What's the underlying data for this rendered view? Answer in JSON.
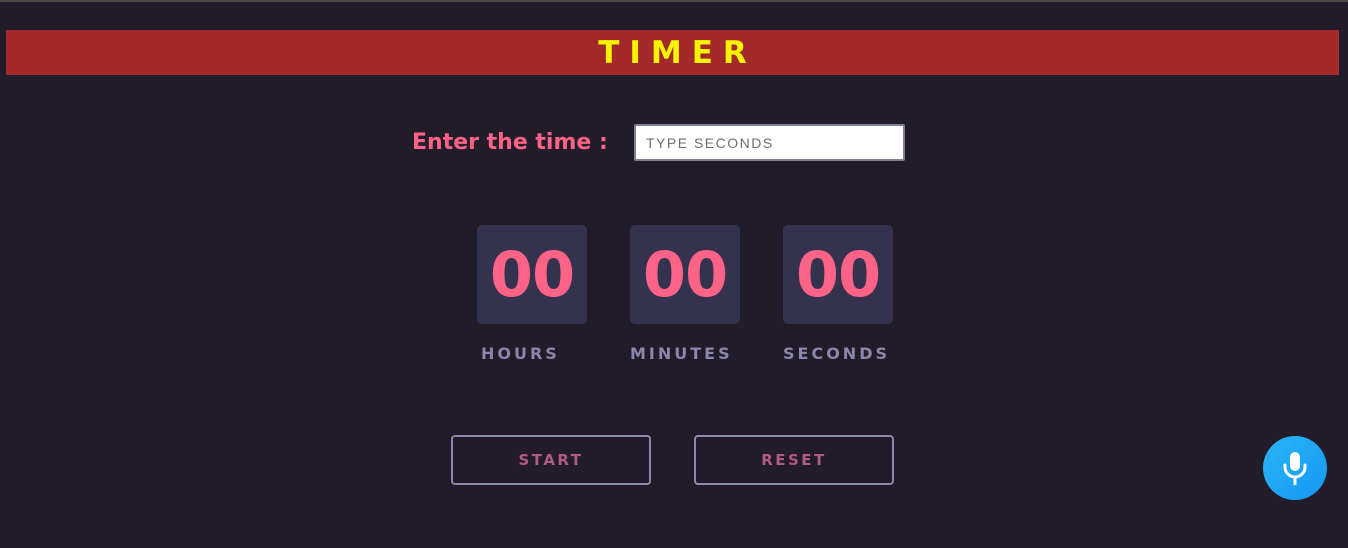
{
  "header": {
    "title": "TIMER"
  },
  "time_input": {
    "label": "Enter the time :",
    "placeholder": "TYPE SECONDS",
    "value": ""
  },
  "countdown": {
    "hours": {
      "value": "00",
      "label": "HOURS"
    },
    "minutes": {
      "value": "00",
      "label": "MINUTES"
    },
    "seconds": {
      "value": "00",
      "label": "SECONDS"
    }
  },
  "controls": {
    "start_label": "START",
    "reset_label": "RESET"
  },
  "voice": {
    "icon": "microphone-icon"
  },
  "colors": {
    "background": "#211b2a",
    "title_bar": "#a3292b",
    "title_text": "#f6f400",
    "accent_pink": "#fd6287",
    "digit_box": "#34324f",
    "muted_label": "#8c86ad",
    "button_text": "#b05a84",
    "mic_blue": "#1ea7f5"
  }
}
